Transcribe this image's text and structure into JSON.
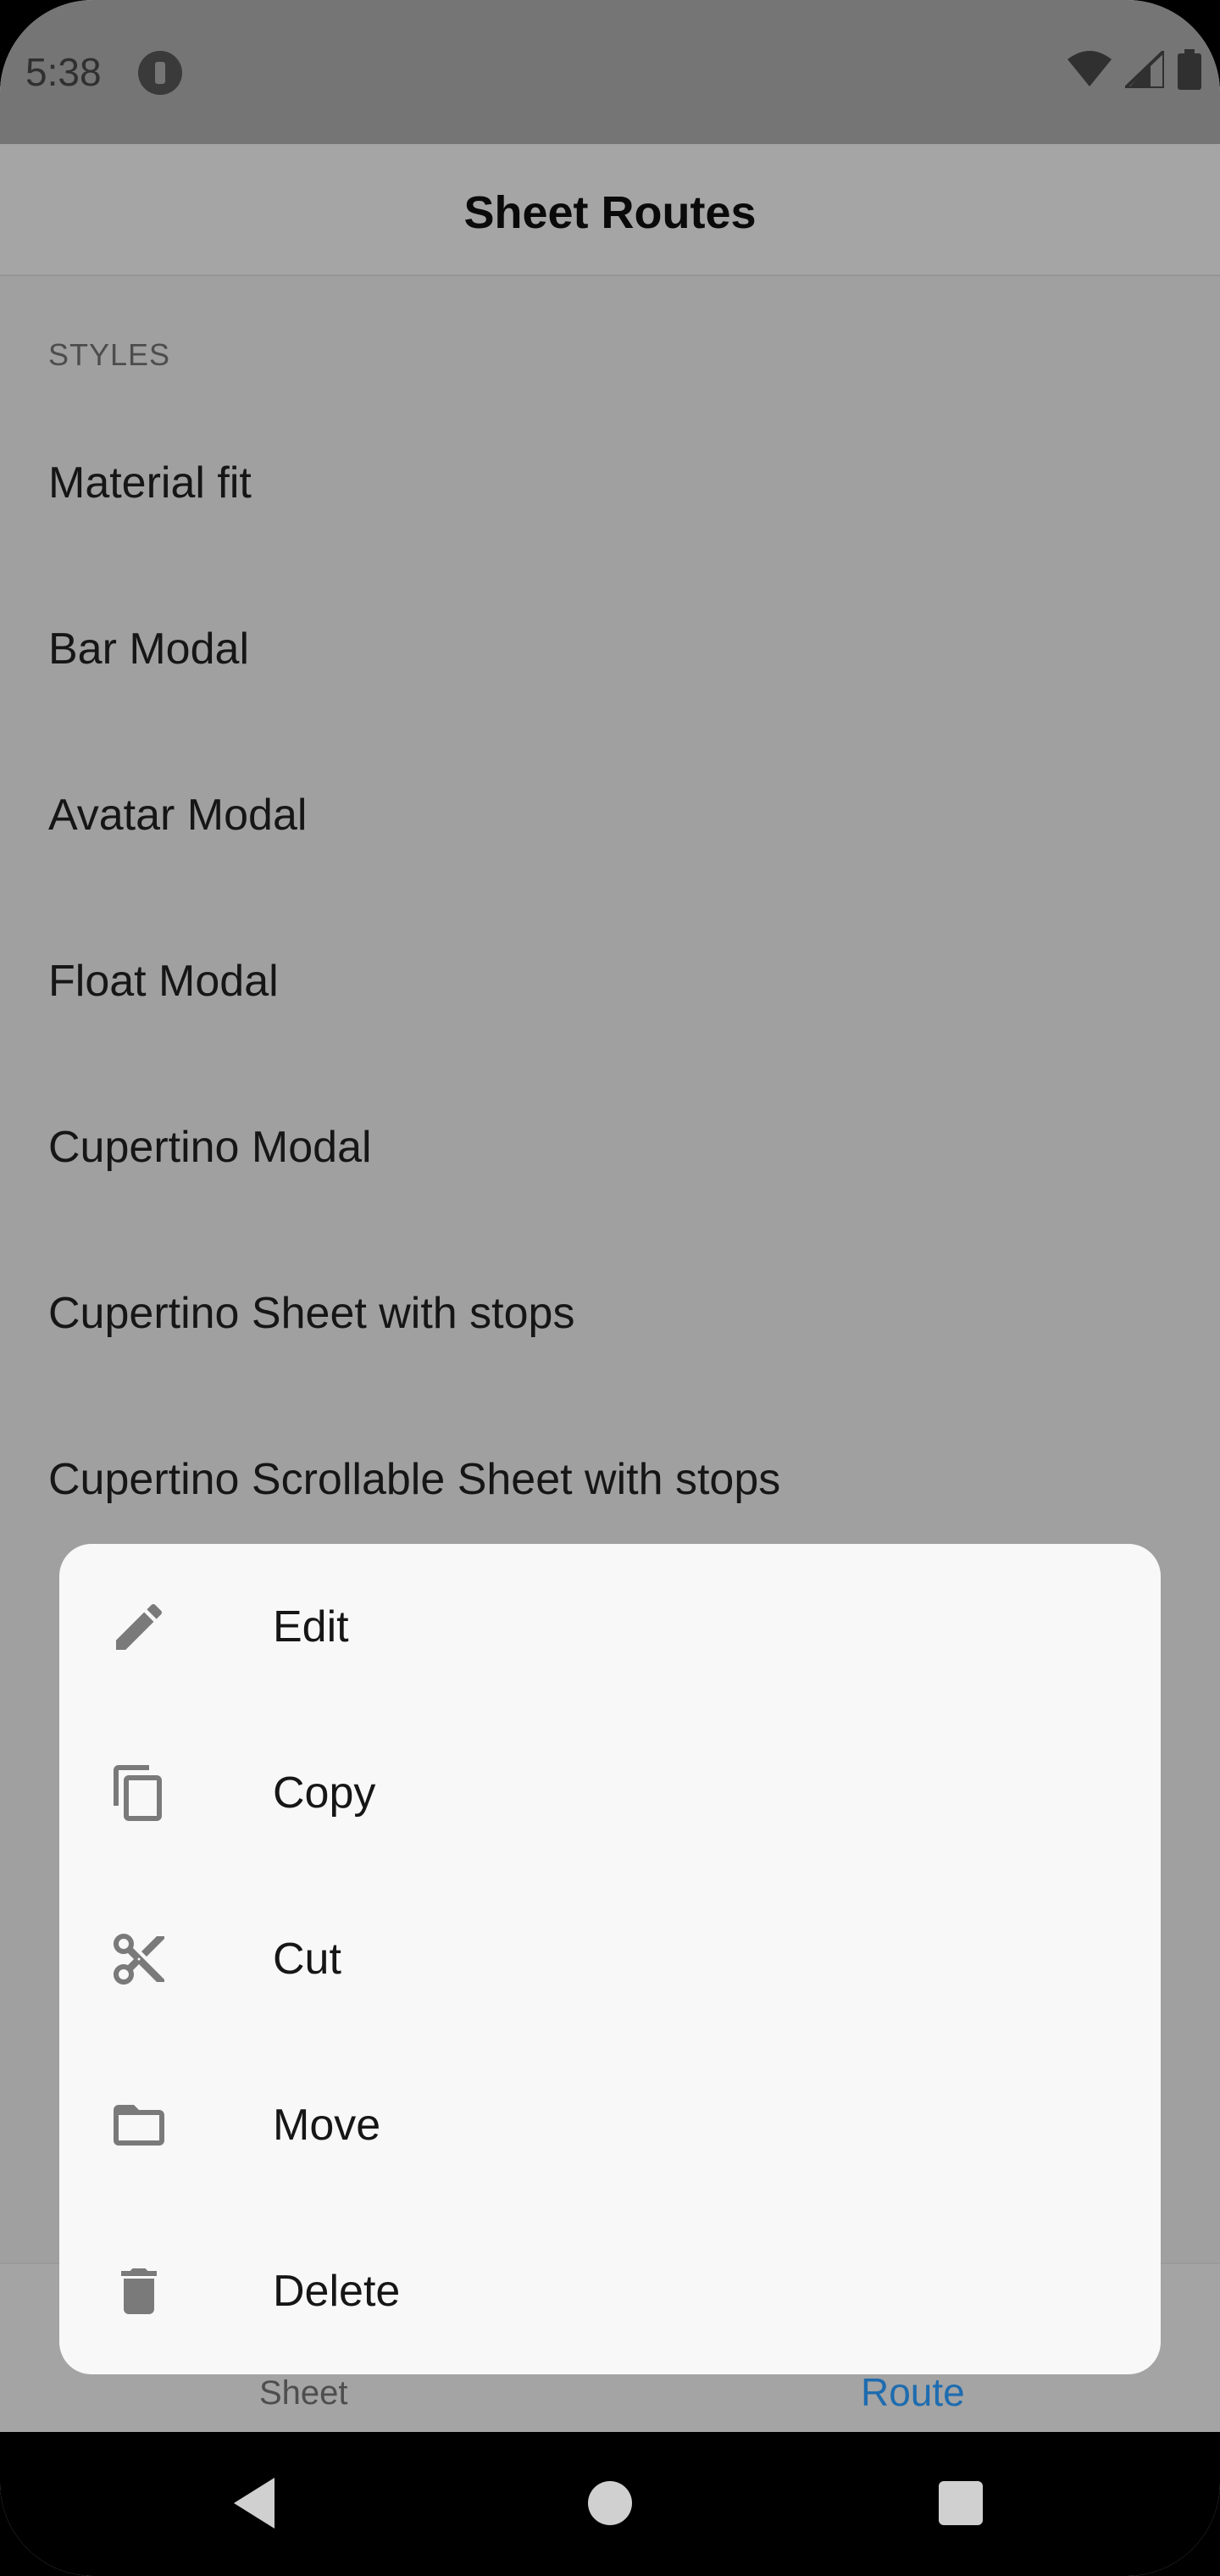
{
  "status_bar": {
    "time": "5:38",
    "icons": [
      "app-notification-icon",
      "wifi-icon",
      "signal-icon",
      "battery-icon"
    ]
  },
  "app_bar": {
    "title": "Sheet Routes"
  },
  "sections": [
    {
      "header": "STYLES",
      "items": [
        "Material fit",
        "Bar Modal",
        "Avatar Modal",
        "Float Modal",
        "Cupertino Modal",
        "Cupertino Sheet with stops",
        "Cupertino Scrollable Sheet with stops"
      ]
    }
  ],
  "bottom_nav": {
    "tabs": [
      {
        "label": "Sheet",
        "active": false
      },
      {
        "label": "Route",
        "active": true
      }
    ],
    "active_color": "#1e6cb0"
  },
  "action_sheet": {
    "items": [
      {
        "label": "Edit",
        "icon": "pencil-icon"
      },
      {
        "label": "Copy",
        "icon": "copy-icon"
      },
      {
        "label": "Cut",
        "icon": "scissors-icon"
      },
      {
        "label": "Move",
        "icon": "folder-icon"
      },
      {
        "label": "Delete",
        "icon": "trash-icon"
      }
    ]
  },
  "system_nav": {
    "buttons": [
      "back-icon",
      "home-icon",
      "recents-icon"
    ]
  }
}
